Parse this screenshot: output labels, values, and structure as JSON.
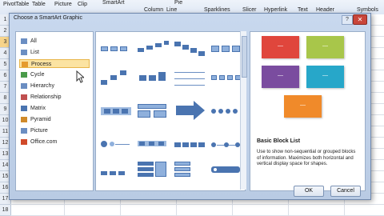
{
  "ribbon": {
    "items": [
      "PivotTable",
      "Table",
      "Picture",
      "Clip",
      "SmartArt",
      "Pie",
      "Column",
      "Line",
      "Sparklines",
      "Slicer",
      "Hyperlink",
      "Text",
      "Header",
      "Symbols"
    ]
  },
  "sheet": {
    "rows": [
      "1",
      "2",
      "3",
      "4",
      "5",
      "6",
      "7",
      "8",
      "9",
      "10",
      "11",
      "12",
      "13",
      "14",
      "15",
      "16",
      "17",
      "18"
    ]
  },
  "dialog": {
    "title": "Choose a SmartArt Graphic",
    "help": "?",
    "close": "✕",
    "categories": [
      {
        "label": "All",
        "icon": "all-icon",
        "selected": false
      },
      {
        "label": "List",
        "icon": "list-icon",
        "selected": false
      },
      {
        "label": "Process",
        "icon": "process-icon",
        "selected": true
      },
      {
        "label": "Cycle",
        "icon": "cycle-icon",
        "selected": false
      },
      {
        "label": "Hierarchy",
        "icon": "hierarchy-icon",
        "selected": false
      },
      {
        "label": "Relationship",
        "icon": "relationship-icon",
        "selected": false
      },
      {
        "label": "Matrix",
        "icon": "matrix-icon",
        "selected": false
      },
      {
        "label": "Pyramid",
        "icon": "pyramid-icon",
        "selected": false
      },
      {
        "label": "Picture",
        "icon": "picture-icon",
        "selected": false
      },
      {
        "label": "Office.com",
        "icon": "office-icon",
        "selected": false
      }
    ],
    "preview": {
      "blocks": [
        {
          "color": "#e0463c",
          "text": "—"
        },
        {
          "color": "#a8c64a",
          "text": "—"
        },
        {
          "color": "#7a4c9f",
          "text": "—"
        },
        {
          "color": "#27a7c9",
          "text": "—"
        },
        {
          "color": "#f08a2a",
          "text": "—"
        }
      ],
      "title": "Basic Block List",
      "description": "Use to show non-sequential or grouped blocks of information. Maximizes both horizontal and vertical display space for shapes."
    },
    "ok_label": "OK",
    "cancel_label": "Cancel"
  }
}
